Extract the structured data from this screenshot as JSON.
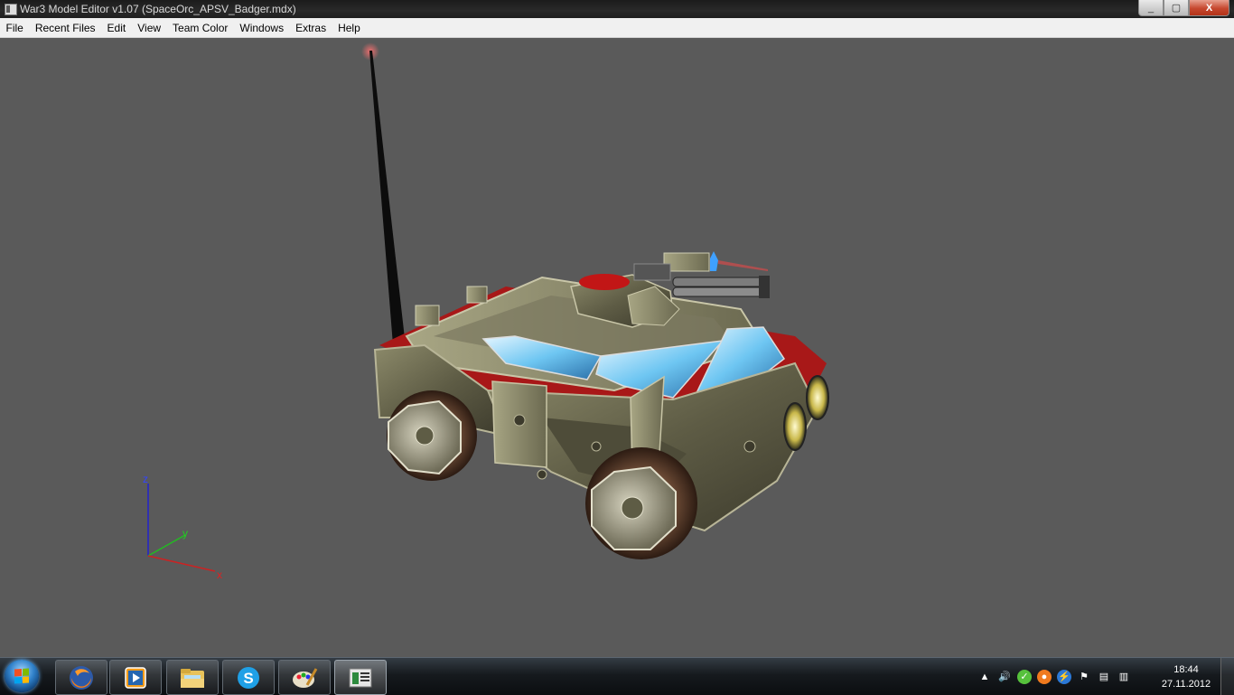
{
  "window": {
    "title": "War3 Model Editor v1.07 (SpaceOrc_APSV_Badger.mdx)",
    "icon": "app-icon",
    "buttons": {
      "minimize": "_",
      "maximize": "▢",
      "close": "X"
    }
  },
  "menu": {
    "items": [
      "File",
      "Recent Files",
      "Edit",
      "View",
      "Team Color",
      "Windows",
      "Extras",
      "Help"
    ]
  },
  "viewport": {
    "background": "#5a5a5a",
    "axes": {
      "x": "x",
      "y": "y",
      "z": "z"
    },
    "axis_colors": {
      "x": "#cc2222",
      "y": "#22bb22",
      "z": "#2222cc"
    }
  },
  "taskbar": {
    "apps": [
      {
        "name": "firefox-icon"
      },
      {
        "name": "media-player-icon"
      },
      {
        "name": "explorer-folder-icon"
      },
      {
        "name": "skype-icon"
      },
      {
        "name": "paint-icon"
      },
      {
        "name": "model-editor-icon",
        "active": true
      }
    ],
    "tray": [
      "show-hidden-icons",
      "volume-icon",
      "green-app-icon",
      "orange-app-icon",
      "blue-lightning-icon",
      "action-center-icon",
      "device-icon",
      "network-icon"
    ],
    "clock": {
      "time": "18:44",
      "date": "27.11.2012"
    }
  }
}
